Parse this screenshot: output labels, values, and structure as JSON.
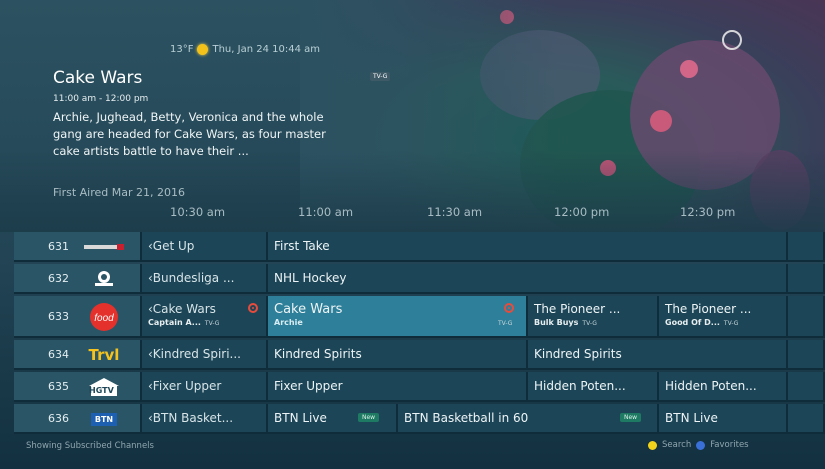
{
  "status_bar": {
    "temperature": "13°F",
    "datetime": "Thu, Jan 24 10:44 am",
    "weather_icon": "sun-icon"
  },
  "program": {
    "title": "Cake Wars",
    "rating": "TV-G",
    "time": "11:00 am - 12:00 pm",
    "description": "Archie, Jughead, Betty, Veronica and the whole gang are headed for Cake Wars, as four master cake artists battle to have their ...",
    "first_aired": "First Aired Mar 21, 2016"
  },
  "timeline": [
    "10:30 am",
    "11:00 am",
    "11:30 am",
    "12:00 pm",
    "12:30 pm"
  ],
  "channels": [
    {
      "number": "631",
      "logo": "espn2",
      "programs": [
        {
          "title": "‹Get Up"
        },
        {
          "title": "First Take"
        }
      ]
    },
    {
      "number": "632",
      "logo": "nbcsn",
      "programs": [
        {
          "title": "‹Bundesliga ..."
        },
        {
          "title": "NHL Hockey"
        }
      ]
    },
    {
      "number": "633",
      "logo": "food",
      "programs": [
        {
          "title": "‹Cake Wars",
          "subtitle": "Captain A...",
          "rating": "TV-G",
          "record": true
        },
        {
          "title": "Cake Wars",
          "subtitle": "Archie",
          "rating": "TV-G",
          "record": true,
          "selected": true
        },
        {
          "title": "The Pioneer ...",
          "subtitle": "Bulk Buys",
          "rating": "TV-G"
        },
        {
          "title": "The Pioneer ...",
          "subtitle": "Good Of D...",
          "rating": "TV-G"
        }
      ]
    },
    {
      "number": "634",
      "logo": "trvl",
      "logo_text": "Trvl",
      "programs": [
        {
          "title": "‹Kindred Spiri..."
        },
        {
          "title": "Kindred Spirits"
        },
        {
          "title": "Kindred Spirits"
        }
      ]
    },
    {
      "number": "635",
      "logo": "hgtv",
      "logo_text": "HGTV",
      "programs": [
        {
          "title": "‹Fixer Upper"
        },
        {
          "title": "Fixer Upper"
        },
        {
          "title": "Hidden Poten..."
        },
        {
          "title": "Hidden Poten..."
        }
      ]
    },
    {
      "number": "636",
      "logo": "btn",
      "logo_text": "BTN",
      "programs": [
        {
          "title": "‹BTN Basket..."
        },
        {
          "title": "BTN Live",
          "badge": "New"
        },
        {
          "title": "BTN Basketball in 60",
          "badge": "New"
        },
        {
          "title": "BTN Live"
        }
      ]
    }
  ],
  "footer": {
    "left": "Showing Subscribed Channels",
    "search": "Search",
    "favorites": "Favorites"
  },
  "colors": {
    "accent_selected": "#2e7f99",
    "search_dot": "#f2d21b",
    "favorites_dot": "#3a6fd8",
    "record": "#e84b3c"
  }
}
